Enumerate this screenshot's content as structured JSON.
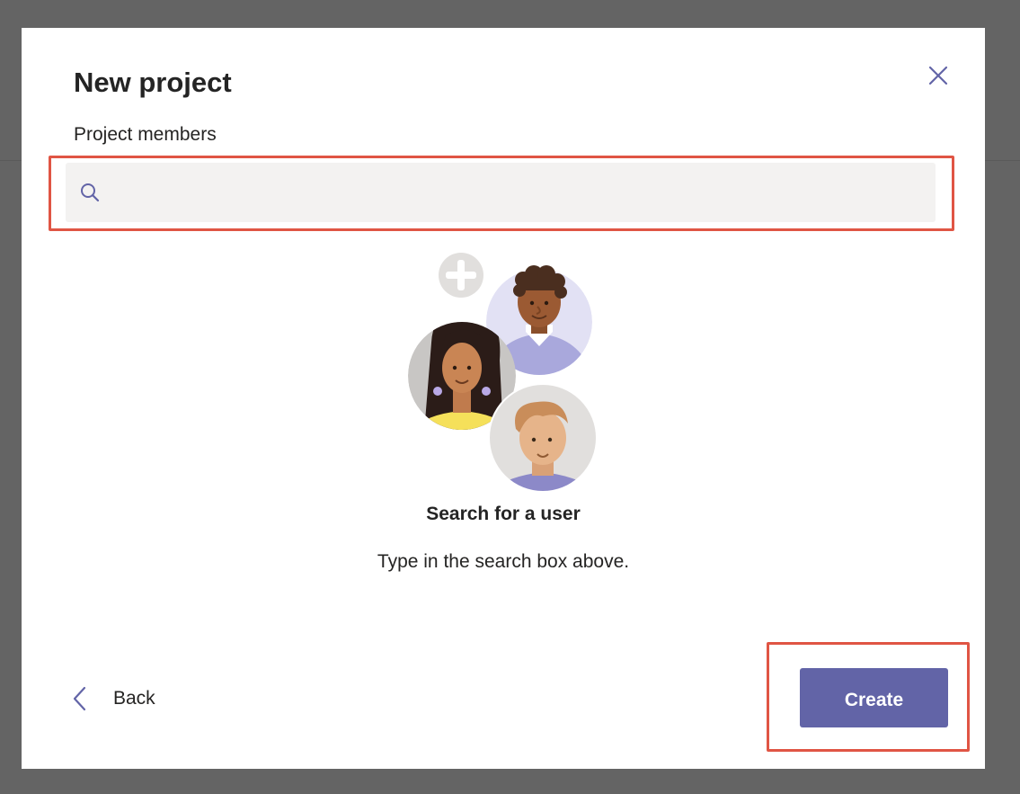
{
  "dialog": {
    "title": "New project",
    "members_label": "Project members",
    "close_icon": "close-icon"
  },
  "search": {
    "icon": "search-icon",
    "value": "",
    "placeholder": ""
  },
  "empty_state": {
    "title": "Search for a user",
    "subtitle": "Type in the search box above."
  },
  "footer": {
    "back_label": "Back",
    "back_icon": "chevron-left-icon",
    "create_label": "Create"
  },
  "colors": {
    "accent": "#6264a7",
    "highlight": "#e05544",
    "overlay": "#646464",
    "search_bg": "#f3f2f1"
  }
}
